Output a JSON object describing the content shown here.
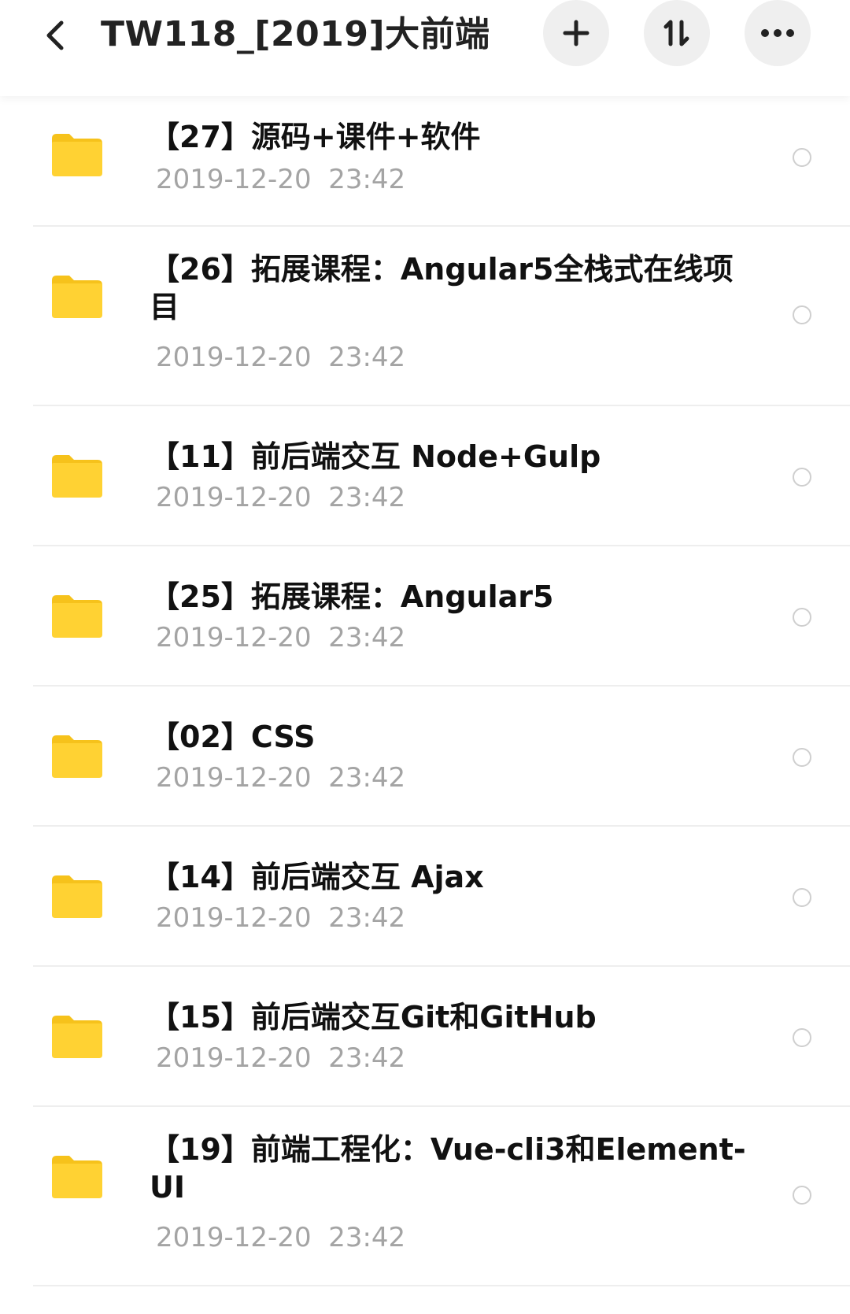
{
  "header": {
    "title": "TW118_[2019]大前端",
    "add_icon": "plus-icon",
    "sort_icon": "sort-icon",
    "more_icon": "more-icon",
    "back_icon": "chevron-left-icon"
  },
  "colors": {
    "folder": "#ffd233",
    "folder_tab": "#f6c21b",
    "date_text": "#a4a4a4",
    "button_bg": "#efefef"
  },
  "files": [
    {
      "name": "【27】源码+课件+软件",
      "date": "2019-12-20  23:42"
    },
    {
      "name": "【26】拓展课程：Angular5全栈式在线项目",
      "date": "2019-12-20  23:42"
    },
    {
      "name": "【11】前后端交互 Node+Gulp",
      "date": "2019-12-20  23:42"
    },
    {
      "name": "【25】拓展课程：Angular5",
      "date": "2019-12-20  23:42"
    },
    {
      "name": "【02】CSS",
      "date": "2019-12-20  23:42"
    },
    {
      "name": "【14】前后端交互 Ajax",
      "date": "2019-12-20  23:42"
    },
    {
      "name": "【15】前后端交互Git和GitHub",
      "date": "2019-12-20  23:42"
    },
    {
      "name": "【19】前端工程化：Vue-cli3和Element-UI",
      "date": "2019-12-20  23:42"
    }
  ]
}
